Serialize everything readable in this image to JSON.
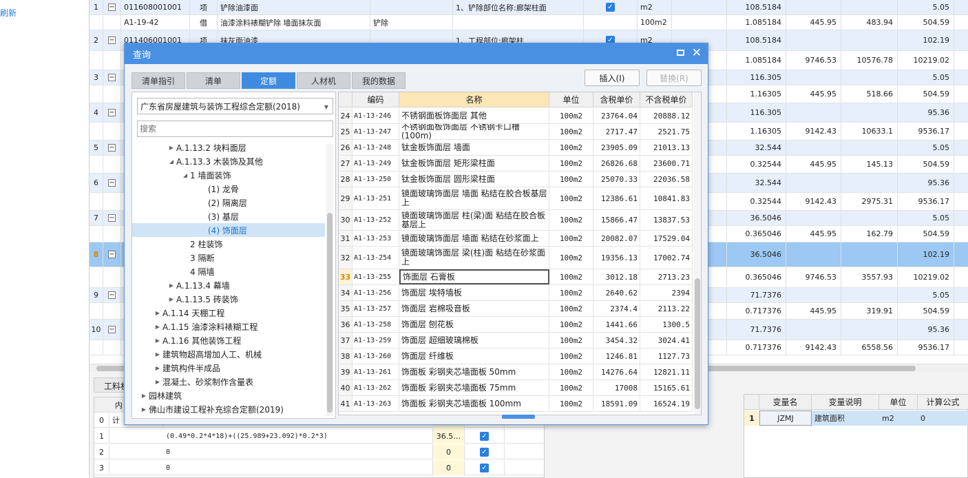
{
  "left_strip": {
    "refresh_label": "刷新"
  },
  "background_rows": [
    {
      "no": "1",
      "code": "011608001001",
      "type": "项",
      "name": "铲除油漆面",
      "feature": "1、铲除部位名称:廊架柱面",
      "checked": true,
      "unit": "m2",
      "qty": "108.5184",
      "v1": "",
      "v2": "",
      "v3": "5.05",
      "style": "hi"
    },
    {
      "no": "",
      "code": "A1-19-42",
      "type": "借",
      "name": "油漆涂料裱糊铲除 墙面抹灰面",
      "extra": "铲除",
      "feature": "",
      "checked": false,
      "unit": "100m2",
      "qty": "1.085184",
      "v1": "445.95",
      "v2": "483.94",
      "v3": "504.59",
      "style": ""
    },
    {
      "no": "2",
      "code": "011406001001",
      "type": "项",
      "name": "抹灰面油漆",
      "feature": "1、工程部位:廊架柱",
      "checked": true,
      "unit": "m2",
      "qty": "108.5184",
      "v1": "",
      "v2": "",
      "v3": "102.19",
      "style": "hi"
    },
    {
      "no": "",
      "code": "",
      "type": "",
      "name": "",
      "feature": "",
      "checked": false,
      "unit": "",
      "qty": "1.085184",
      "v1": "9746.53",
      "v2": "10576.78",
      "v3": "10219.02",
      "style": ""
    },
    {
      "no": "3",
      "code": "",
      "type": "",
      "name": "",
      "feature": "",
      "checked": false,
      "unit": "",
      "qty": "116.305",
      "v1": "",
      "v2": "",
      "v3": "5.05",
      "style": "hi"
    },
    {
      "no": "",
      "code": "",
      "type": "",
      "name": "",
      "feature": "",
      "checked": false,
      "unit": "",
      "qty": "1.16305",
      "v1": "445.95",
      "v2": "518.66",
      "v3": "504.59",
      "style": ""
    },
    {
      "no": "4",
      "code": "",
      "type": "",
      "name": "",
      "feature": "",
      "checked": false,
      "unit": "",
      "qty": "116.305",
      "v1": "",
      "v2": "",
      "v3": "95.36",
      "style": "hi"
    },
    {
      "no": "",
      "code": "",
      "type": "",
      "name": "",
      "feature": "",
      "checked": false,
      "unit": "",
      "qty": "1.16305",
      "v1": "9142.43",
      "v2": "10633.1",
      "v3": "9536.17",
      "style": ""
    },
    {
      "no": "5",
      "code": "",
      "type": "",
      "name": "",
      "feature": "",
      "checked": false,
      "unit": "",
      "qty": "32.544",
      "v1": "",
      "v2": "",
      "v3": "5.05",
      "style": "hi"
    },
    {
      "no": "",
      "code": "",
      "type": "",
      "name": "",
      "feature": "",
      "checked": false,
      "unit": "",
      "qty": "0.32544",
      "v1": "445.95",
      "v2": "145.13",
      "v3": "504.59",
      "style": ""
    },
    {
      "no": "6",
      "code": "",
      "type": "",
      "name": "",
      "feature": "",
      "checked": false,
      "unit": "",
      "qty": "32.544",
      "v1": "",
      "v2": "",
      "v3": "95.36",
      "style": "hi"
    },
    {
      "no": "",
      "code": "",
      "type": "",
      "name": "",
      "feature": "",
      "checked": false,
      "unit": "",
      "qty": "0.32544",
      "v1": "9142.43",
      "v2": "2975.31",
      "v3": "9536.17",
      "style": ""
    },
    {
      "no": "7",
      "code": "",
      "type": "",
      "name": "",
      "feature": "",
      "checked": false,
      "unit": "",
      "qty": "36.5046",
      "v1": "",
      "v2": "",
      "v3": "5.05",
      "style": "hi"
    },
    {
      "no": "",
      "code": "",
      "type": "",
      "name": "",
      "feature": "",
      "checked": false,
      "unit": "",
      "qty": "0.365046",
      "v1": "445.95",
      "v2": "162.79",
      "v3": "504.59",
      "style": ""
    },
    {
      "no": "8",
      "code": "",
      "type": "",
      "name": "",
      "feature": "",
      "checked": false,
      "unit": "",
      "qty": "36.5046",
      "v1": "",
      "v2": "",
      "v3": "102.19",
      "style": "sel"
    },
    {
      "no": "",
      "code": "",
      "type": "",
      "name": "",
      "feature": "",
      "checked": false,
      "unit": "",
      "qty": "0.365046",
      "v1": "9746.53",
      "v2": "3557.93",
      "v3": "10219.02",
      "style": ""
    },
    {
      "no": "9",
      "code": "",
      "type": "",
      "name": "",
      "feature": "",
      "checked": false,
      "unit": "",
      "qty": "71.7376",
      "v1": "",
      "v2": "",
      "v3": "5.05",
      "style": "hi"
    },
    {
      "no": "",
      "code": "",
      "type": "",
      "name": "",
      "feature": "",
      "checked": false,
      "unit": "",
      "qty": "0.717376",
      "v1": "445.95",
      "v2": "319.91",
      "v3": "504.59",
      "style": ""
    },
    {
      "no": "10",
      "code": "",
      "type": "",
      "name": "",
      "feature": "",
      "checked": false,
      "unit": "",
      "qty": "71.7376",
      "v1": "",
      "v2": "",
      "v3": "95.36",
      "style": "hi"
    },
    {
      "no": "",
      "code": "",
      "type": "",
      "name": "",
      "feature": "",
      "checked": false,
      "unit": "",
      "qty": "0.717376",
      "v1": "9142.43",
      "v2": "6558.56",
      "v3": "9536.17",
      "style": ""
    }
  ],
  "lower_panel": {
    "tab_label": "工料机",
    "header_frag": "内",
    "rows": [
      {
        "no": "0",
        "expr": "计",
        "value": "",
        "checked": false
      },
      {
        "no": "1",
        "expr": "(0.49*0.2*4*18)+((25.989+23.092)*0.2*3)",
        "value": "36.5…",
        "checked": true
      },
      {
        "no": "2",
        "expr": "0",
        "value": "0",
        "checked": true
      },
      {
        "no": "3",
        "expr": "0",
        "value": "0",
        "checked": true
      }
    ]
  },
  "var_table": {
    "headers": [
      "变量名",
      "变量说明",
      "单位",
      "计算公式"
    ],
    "row": {
      "no": "1",
      "name": "JZMJ",
      "desc": "建筑面积",
      "unit": "m2",
      "formula": "0"
    }
  },
  "dialog": {
    "title": "查询",
    "tabs": [
      "清单指引",
      "清单",
      "定额",
      "人材机",
      "我的数据"
    ],
    "active_tab": 2,
    "insert_label": "插入(I)",
    "replace_label": "替换(R)",
    "quota_select": "广东省房屋建筑与装饰工程综合定额(2018)",
    "search_placeholder": "搜索",
    "tree": [
      {
        "label": "A.1.13.2 块料面层",
        "level": 2,
        "tri": "right"
      },
      {
        "label": "A.1.13.3 木装饰及其他",
        "level": 2,
        "tri": "down"
      },
      {
        "label": "1 墙面装饰",
        "level": 3,
        "tri": "down"
      },
      {
        "label": "(1) 龙骨",
        "level": 4,
        "tri": ""
      },
      {
        "label": "(2) 隔离层",
        "level": 4,
        "tri": ""
      },
      {
        "label": "(3) 基层",
        "level": 4,
        "tri": ""
      },
      {
        "label": "(4) 饰面层",
        "level": 4,
        "tri": "",
        "selected": true
      },
      {
        "label": "2 柱装饰",
        "level": 3,
        "tri": ""
      },
      {
        "label": "3 隔断",
        "level": 3,
        "tri": ""
      },
      {
        "label": "4 隔墙",
        "level": 3,
        "tri": ""
      },
      {
        "label": "A.1.13.4 幕墙",
        "level": 2,
        "tri": "right"
      },
      {
        "label": "A.1.13.5 砖装饰",
        "level": 2,
        "tri": "right"
      },
      {
        "label": "A.1.14 天棚工程",
        "level": 1,
        "tri": "right"
      },
      {
        "label": "A.1.15 油漆涂料裱糊工程",
        "level": 1,
        "tri": "right"
      },
      {
        "label": "A.1.16 其他装饰工程",
        "level": 1,
        "tri": "right"
      },
      {
        "label": "建筑物超高增加人工、机械",
        "level": 1,
        "tri": "right"
      },
      {
        "label": "建筑构件半成品",
        "level": 1,
        "tri": "right"
      },
      {
        "label": "混凝土、砂浆制作含量表",
        "level": 1,
        "tri": "right"
      },
      {
        "label": "园林建筑",
        "level": 0,
        "tri": "right"
      },
      {
        "label": "佛山市建设工程补充综合定额(2019)",
        "level": 0,
        "tri": "right"
      }
    ],
    "grid_headers": [
      "",
      "编码",
      "名称",
      "单位",
      "含税单价",
      "不含税单价"
    ],
    "grid_rows": [
      {
        "i": "24",
        "code": "A1-13-246",
        "name": "不锈钢面板饰面层 其他",
        "unit": "100m2",
        "tax": "23764.04",
        "notax": "20888.12"
      },
      {
        "i": "25",
        "code": "A1-13-247",
        "name": "不锈钢面板饰面层 不锈钢卡口槽(100m)",
        "unit": "100m2",
        "tax": "2717.47",
        "notax": "2521.75"
      },
      {
        "i": "26",
        "code": "A1-13-248",
        "name": "钛金板饰面层 墙面",
        "unit": "100m2",
        "tax": "23905.09",
        "notax": "21013.13"
      },
      {
        "i": "27",
        "code": "A1-13-249",
        "name": "钛金板饰面层 矩形梁柱面",
        "unit": "100m2",
        "tax": "26826.68",
        "notax": "23600.71"
      },
      {
        "i": "28",
        "code": "A1-13-250",
        "name": "钛金板饰面层 圆形梁柱面",
        "unit": "100m2",
        "tax": "25070.33",
        "notax": "22036.58"
      },
      {
        "i": "29",
        "code": "A1-13-251",
        "name": "镜面玻璃饰面层 墙面 粘结在胶合板基层上",
        "unit": "100m2",
        "tax": "12386.61",
        "notax": "10841.83"
      },
      {
        "i": "30",
        "code": "A1-13-252",
        "name": "镜面玻璃饰面层 柱(梁)面 粘结在胶合板基层上",
        "unit": "100m2",
        "tax": "15866.47",
        "notax": "13837.53"
      },
      {
        "i": "31",
        "code": "A1-13-253",
        "name": "镜面玻璃饰面层 墙面 粘结在砂浆面上",
        "unit": "100m2",
        "tax": "20082.07",
        "notax": "17529.04"
      },
      {
        "i": "32",
        "code": "A1-13-254",
        "name": "镜面玻璃饰面层 梁(柱)面 粘结在砂浆面上",
        "unit": "100m2",
        "tax": "19356.13",
        "notax": "17002.74"
      },
      {
        "i": "33",
        "code": "A1-13-255",
        "name": "饰面层 石膏板",
        "unit": "100m2",
        "tax": "3012.18",
        "notax": "2713.23",
        "current": true
      },
      {
        "i": "34",
        "code": "A1-13-256",
        "name": "饰面层 埃特墙板",
        "unit": "100m2",
        "tax": "2640.62",
        "notax": "2394"
      },
      {
        "i": "35",
        "code": "A1-13-257",
        "name": "饰面层 岩棉吸音板",
        "unit": "100m2",
        "tax": "2374.4",
        "notax": "2113.22"
      },
      {
        "i": "36",
        "code": "A1-13-258",
        "name": "饰面层 刨花板",
        "unit": "100m2",
        "tax": "1441.66",
        "notax": "1300.5"
      },
      {
        "i": "37",
        "code": "A1-13-259",
        "name": "饰面层 超细玻璃棉板",
        "unit": "100m2",
        "tax": "3454.32",
        "notax": "3024.41"
      },
      {
        "i": "38",
        "code": "A1-13-260",
        "name": "饰面层 纤维板",
        "unit": "100m2",
        "tax": "1246.81",
        "notax": "1127.73"
      },
      {
        "i": "39",
        "code": "A1-13-261",
        "name": "饰面板 彩钢夹芯墙面板 50mm",
        "unit": "100m2",
        "tax": "14276.64",
        "notax": "12821.11"
      },
      {
        "i": "40",
        "code": "A1-13-262",
        "name": "饰面板 彩钢夹芯墙面板 75mm",
        "unit": "100m2",
        "tax": "17008",
        "notax": "15165.61"
      },
      {
        "i": "41",
        "code": "A1-13-263",
        "name": "饰面板 彩钢夹芯墙面板 100mm",
        "unit": "100m2",
        "tax": "18591.09",
        "notax": "16524.19"
      }
    ]
  }
}
